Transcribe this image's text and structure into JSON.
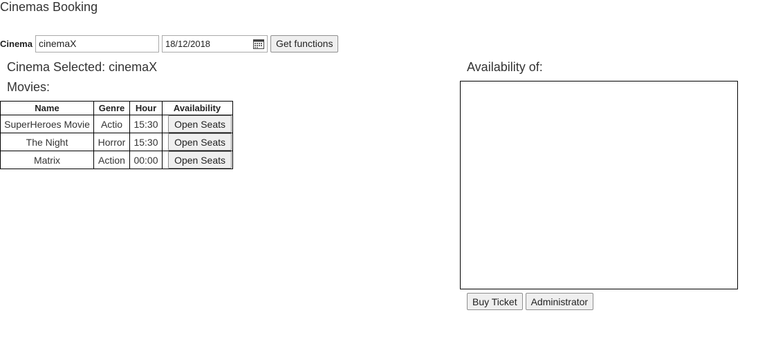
{
  "app": {
    "title": "Cinemas Booking"
  },
  "form": {
    "cinema_label": "Cinema",
    "cinema_value": "cinemaX",
    "date_value": "18/12/2018",
    "get_functions_label": "Get functions"
  },
  "selection": {
    "selected_text": "Cinema Selected: cinemaX",
    "movies_heading": "Movies:"
  },
  "table": {
    "headers": [
      "Name",
      "Genre",
      "Hour",
      "Availability"
    ],
    "rows": [
      {
        "name": "SuperHeroes Movie",
        "genre": "Actio",
        "hour": "15:30",
        "action": "Open Seats"
      },
      {
        "name": "The Night",
        "genre": "Horror",
        "hour": "15:30",
        "action": "Open Seats"
      },
      {
        "name": "Matrix",
        "genre": "Action",
        "hour": "00:00",
        "action": "Open Seats"
      }
    ]
  },
  "availability": {
    "title": "Availability of:",
    "buy_ticket_label": "Buy Ticket",
    "administrator_label": "Administrator"
  },
  "icons": {
    "date_picker": "calendar-icon"
  },
  "colors": {
    "text": "#333333",
    "button_bg": "#efefef",
    "border": "#000000"
  }
}
